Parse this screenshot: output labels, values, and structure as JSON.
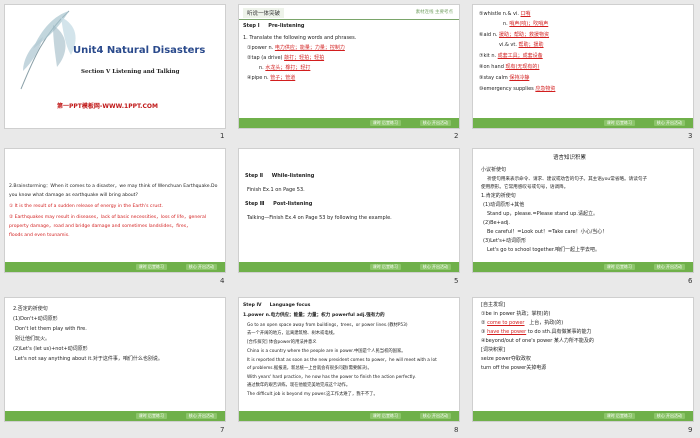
{
  "footer": {
    "btn1": "课时 后堂练习",
    "btn2": "核心 开出活动"
  },
  "s1": {
    "title": "Unit4 Natural Disasters",
    "section": "Section Ⅴ  Listening and Talking",
    "brand": "第一PPT模板网-WWW.1PPT.COM",
    "num": "1"
  },
  "s2": {
    "hdr": "听说一体突破",
    "hdr_r": "素材连线  主要考点",
    "step": "Step Ⅰ",
    "step_name": "Pre-listening",
    "l0": "1. Translate the following words and phrases.",
    "l1": "①power n. ",
    "a1": "电力供应；能量；力量；控制力",
    "l2": "②tap (a drive) ",
    "a2": "敲打；轻拍；轻拍",
    "l3": "n. ",
    "a3": "水龙头；橡打；轻打",
    "l4": "④pipe n. ",
    "a4": "管子；管道",
    "num": "2"
  },
  "s3": {
    "l1": "⑤whistle n.& vi. ",
    "a1": "口哨",
    "l2": "n. ",
    "a2": "哨声(响)；吹哨声",
    "l3": "⑥aid n. ",
    "a3": "援助；帮助；救援物资",
    "l4": "vi.& vt. ",
    "a4": "帮助；援助",
    "l5": "⑦kit n. ",
    "a5": "成套工具；成套设备",
    "l6": "⑧on hand ",
    "a6": "现有(无现有的)",
    "l7": "⑨stay calm ",
    "a7": "保持冷静",
    "l8": "⑩emergency supplies ",
    "a8": "应急物资",
    "num": "3"
  },
  "s4": {
    "l1": "2.Brainstorming：When it comes to a disaster，we may think of Wenchuan Earthquake.Do",
    "l2": "you know what damage as earthquake will bring about?",
    "l3": "① It is the result of a sudden release of energy in the Earth's crust.",
    "l4": "② Earthquakes may result in diseases，lack of basic necessities，loss of life，general",
    "l5": "property damage，road and bridge damage and sometimes landslides，fires，",
    "l6": "floods and even tsunamis.",
    "num": "4"
  },
  "s5": {
    "step1": "Step Ⅱ",
    "name1": "While-listening",
    "l1": "Finish Ex.1 on Page 53.",
    "step2": "Step Ⅲ",
    "name2": "Post-listening",
    "l2": "Talking—Finish Ex.4 on Page 53 by following  the example.",
    "num": "5"
  },
  "s6": {
    "title": "语言知识积累",
    "l1": "小议祈使句",
    "l2": "祈使句用来表示命令、请求、建议或劝告的句子。其主语you常省略。请读句子",
    "l3": "使用原形。它常用感叹号或句号，语调降。",
    "l4": "1.肯定的祈使句",
    "l5": "(1)动词原形+其他",
    "l6": "Stand up，please.=Please stand up.请起立。",
    "l7": "(2)Be+adj.",
    "l8": "Be careful！=Look out！=Take care！小心/当心！",
    "l9": "(3)Let's+动词原形",
    "l10": "Let's go to school together.咱们一起上学去吧。",
    "num": "6"
  },
  "s7": {
    "l1": "2.否定的祈使句",
    "l2": "(1)Don't+动词原形",
    "l3": "Don't let them play with fire.",
    "l4": "别让他们玩火。",
    "l5": "(2)Let's (let us)+not+动词原形",
    "l6": "Let's not say anything about it.对于这件事，咱们什么也别说。",
    "num": "7"
  },
  "s8": {
    "step": "Step Ⅳ",
    "name": "Language focus",
    "l1": "1.power n.电力供应；能量；力量；权力    powerful adj.强有力的",
    "l2": "Go to an open space away from buildings，trees，or power lines.(教材P53)",
    "l3": "去一个开阔的地方，远离建筑物、树木或电线。",
    "l4": "[合作探究]   体会power的用法并意义",
    "l5": "China is a country where the people are in power.中国是个人民当权的国家。",
    "l6": "It is reported that as soon as the new president comes to power，he will meet with a lot",
    "l7": "of problems.据报道，新总统一上台就会有很多问题(需要解决)。",
    "l8": "With years' hard practice，he now has the power to finish the action perfectly.",
    "l9": "通过数年的艰苦训练，现在他能完美地完成这个动作。",
    "l10": "The difficult job is beyond my power.这工作太难了，我干不了。",
    "num": "8"
  },
  "s9": {
    "l1": "[自主发现]",
    "l2": "①be in power  执政；掌权(的)",
    "l3": "②",
    "a3": "come to power",
    "r3": "上台，执政(的)",
    "l4": "③",
    "a4": "have the power",
    "r4": "to do sth.具有做某事的能力",
    "l5": "④beyond/out of one's power  某人力所不能及的",
    "l6": "[词块积累]",
    "l7": "seize power夺取政权",
    "l8": "turn off the power关掉电源",
    "num": "9"
  }
}
